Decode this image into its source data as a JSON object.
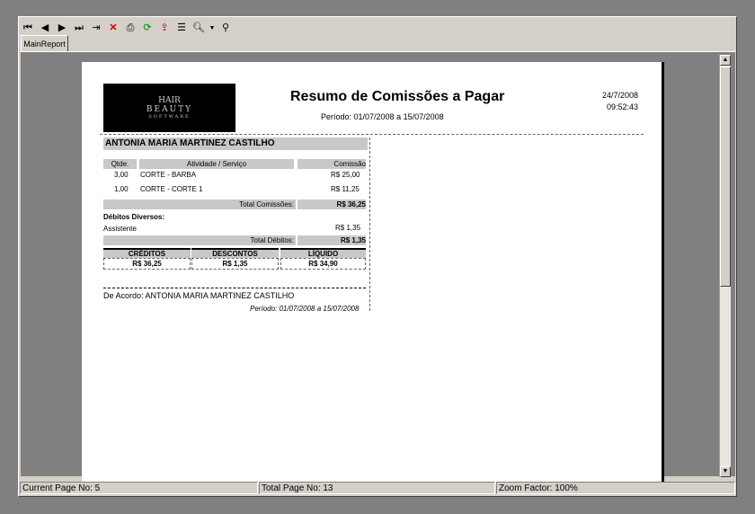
{
  "toolbar": {
    "icons": [
      "first-page-icon",
      "prev-page-icon",
      "next-page-icon",
      "last-page-icon",
      "goto-page-icon",
      "close-icon",
      "print-icon",
      "refresh-icon",
      "export-icon",
      "tree-icon",
      "zoom-icon",
      "search-icon"
    ]
  },
  "tabs": [
    {
      "label": "MainReport"
    }
  ],
  "report": {
    "logo_line1": "HAIR",
    "logo_line2": "BEAUTY",
    "logo_line3": "SOFTWARE",
    "title": "Resumo de Comissões a Pagar",
    "periodo": "Período: 01/07/2008  a   15/07/2008",
    "date": "24/7/2008",
    "time": "09:52:43",
    "employee": "ANTONIA MARIA MARTINEZ CASTILHO",
    "col_qtde": "Qtde.",
    "col_atividade": "Atividade / Serviço",
    "col_comissao": "Comissão",
    "rows": [
      {
        "qtde": "3,00",
        "servico": "CORTE - BARBA",
        "comissao": "R$ 25,00"
      },
      {
        "qtde": "1,00",
        "servico": "CORTE - CORTE 1",
        "comissao": "R$ 11,25"
      }
    ],
    "total_comissoes_label": "Total Comissões:",
    "total_comissoes": "R$ 36,25",
    "debitos_label": "Débitos Diversos:",
    "debito_item": "Assistente",
    "debito_valor": "R$ 1,35",
    "total_debitos_label": "Total Débitos:",
    "total_debitos": "R$ 1,35",
    "creditos_label": "CRÉDITOS",
    "creditos": "R$  36,25",
    "descontos_label": "DESCONTOS",
    "descontos": "R$  1,35",
    "liquido_label": "LÍQUIDO",
    "liquido": "R$  34,90",
    "acordo": "De Acordo:  ANTONIA MARIA MARTINEZ CASTILHO",
    "periodo_footer": "Período: 01/07/2008 a 15/07/2008"
  },
  "status": {
    "current_page": "Current Page No: 5",
    "total_pages": "Total Page No: 13",
    "zoom": "Zoom Factor: 100%"
  }
}
